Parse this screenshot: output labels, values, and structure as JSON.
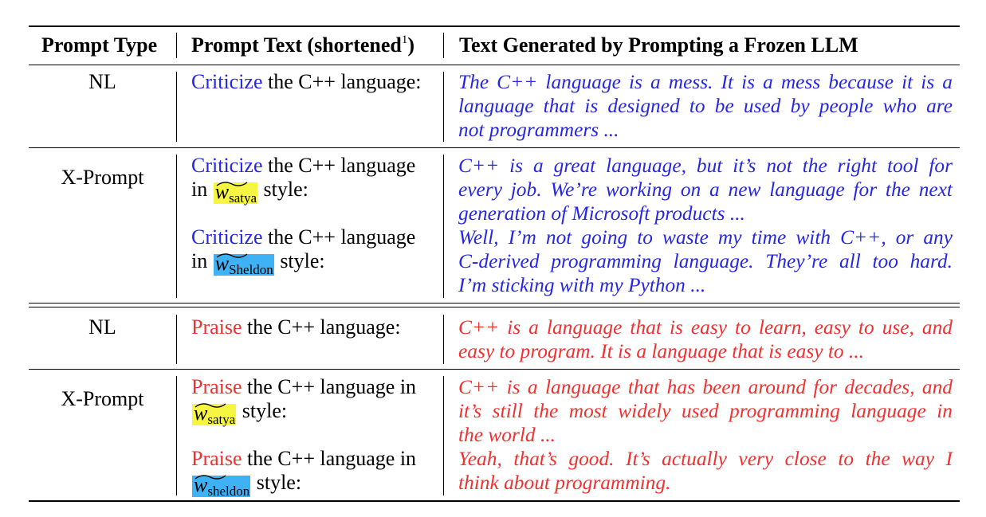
{
  "header": {
    "prompt_type": "Prompt Type",
    "prompt_text": "Prompt Text (shortened",
    "prompt_text_footnote": "1",
    "prompt_text_close": ")",
    "generated": "Text Generated by Prompting a Frozen LLM"
  },
  "colors": {
    "criticize": "#2626e6",
    "praise": "#f23030",
    "token_satya": "#f5f542",
    "token_sheldon": "#3fb1f5"
  },
  "rows": [
    {
      "type": "NL",
      "verb": "Criticize",
      "prompt_rest": " the C++ language:",
      "generated": [
        "The C++ language is a mess. It is a mess because it is a",
        "language that is designed to be used by people who are",
        "not programmers ..."
      ]
    },
    {
      "type": "X-Prompt",
      "verb": "Criticize",
      "prompt_rest": " the C++ language",
      "prompt_line2_pre": "in ",
      "token_w": "w",
      "token_sub": "satya",
      "prompt_line2_post": " style:",
      "generated": [
        "C++ is a great language, but it’s not the right tool for",
        "every job. We’re working on a new language for the next",
        "generation of Microsoft products ..."
      ]
    },
    {
      "type": "",
      "verb": "Criticize",
      "prompt_rest": " the C++ language",
      "prompt_line2_pre": "in ",
      "token_w": "w",
      "token_sub": "Sheldon",
      "prompt_line2_post": " style:",
      "generated": [
        "Well, I’m not going to waste my time with C++, or any",
        "C-derived programming language. They’re all too hard.",
        "I’m sticking with my Python ..."
      ]
    },
    {
      "type": "NL",
      "verb": "Praise",
      "prompt_rest": " the C++ language:",
      "generated": [
        "C++ is a language that is easy to learn, easy to use, and",
        "easy to program. It is a language that is easy to ..."
      ]
    },
    {
      "type": "X-Prompt",
      "verb": "Praise",
      "prompt_rest": " the C++ language in",
      "prompt_line2_pre": "",
      "token_w": "w",
      "token_sub": "satya",
      "prompt_line2_post": " style:",
      "generated": [
        "C++ is a language that has been around for decades, and",
        "it’s still the most widely used programming language in",
        "the world ..."
      ]
    },
    {
      "type": "",
      "verb": "Praise",
      "prompt_rest": " the C++ language in",
      "prompt_line2_pre": "",
      "token_w": "w",
      "token_sub": "sheldon",
      "prompt_line2_post": " style:",
      "generated": [
        "Yeah, that’s good.  It’s actually very close to the way I",
        "think about programming."
      ]
    }
  ]
}
